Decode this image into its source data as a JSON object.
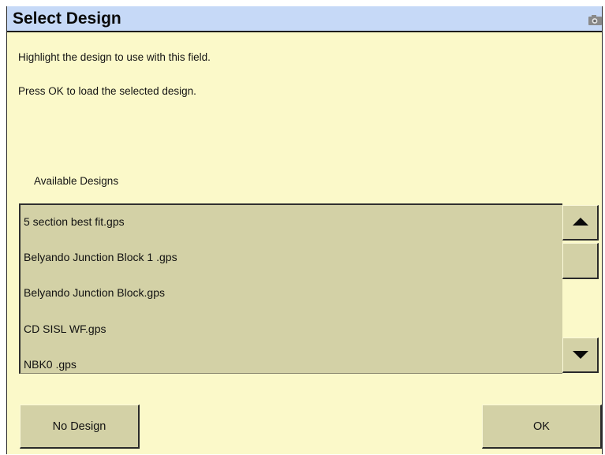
{
  "window": {
    "title": "Select Design"
  },
  "instructions": {
    "line1": "Highlight the design to use with this field.",
    "line2": "Press OK to load the selected design."
  },
  "designs": {
    "label": "Available Designs",
    "items": [
      "5 section best fit.gps",
      "Belyando Junction Block 1 .gps",
      "Belyando Junction Block.gps",
      "CD SISL WF.gps",
      "NBK0 .gps"
    ]
  },
  "buttons": {
    "no_design": "No Design",
    "ok": "OK"
  },
  "icons": {
    "title_right": "camera-icon",
    "scroll_up": "arrow-up-icon",
    "scroll_down": "arrow-down-icon"
  },
  "colors": {
    "background": "#fbf9c9",
    "titlebar": "#c6d9f7",
    "control": "#d3d1a6"
  }
}
